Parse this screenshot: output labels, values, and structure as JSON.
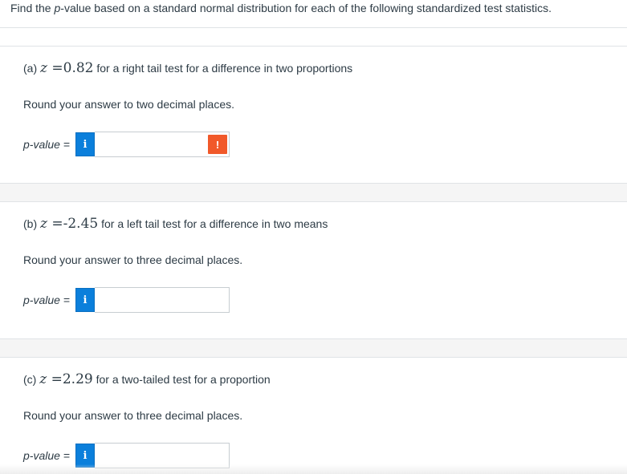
{
  "intro": {
    "before": "Find the ",
    "p": "p",
    "after": "-value based on a standard normal distribution for each of the following standardized test statistics."
  },
  "parts": [
    {
      "label": "(a) ",
      "var": "z",
      "eq": " =",
      "value": "0.82",
      "desc": " for a right tail test for a difference in two proportions",
      "round": "Round your answer to two decimal places.",
      "pvalue_label": "p-value = ",
      "info_icon": "i",
      "input_value": "",
      "warning": "!"
    },
    {
      "label": "(b) ",
      "var": "z",
      "eq": " =",
      "value": "-2.45",
      "desc": " for a left tail test for a difference in two means",
      "round": "Round your answer to three decimal places.",
      "pvalue_label": "p-value = ",
      "info_icon": "i",
      "input_value": ""
    },
    {
      "label": "(c) ",
      "var": "z",
      "eq": " =",
      "value": "2.29",
      "desc": " for a two-tailed test for a proportion",
      "round": "Round your answer to three decimal places.",
      "pvalue_label": "p-value = ",
      "info_icon": "i",
      "input_value": ""
    }
  ],
  "colors": {
    "info": "#0b7fdb",
    "warning": "#f1592a",
    "text": "#2d3b45"
  }
}
